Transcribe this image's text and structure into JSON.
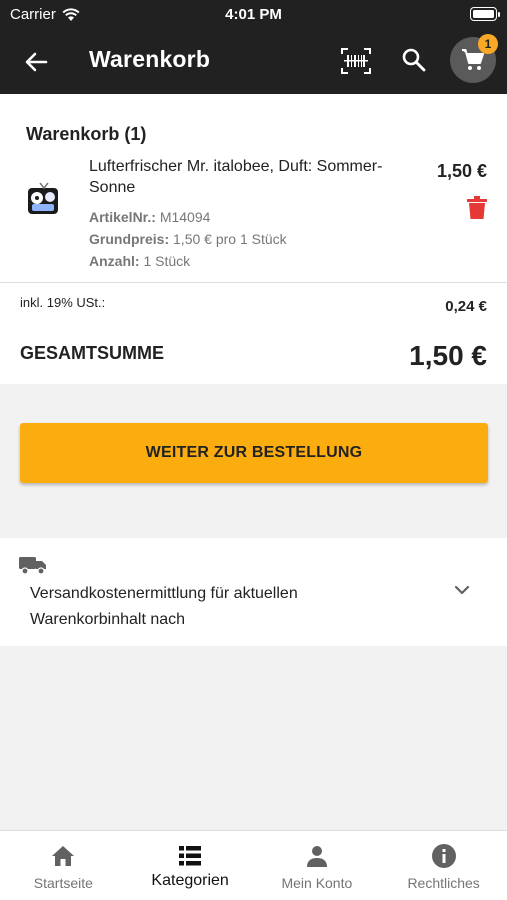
{
  "status_bar": {
    "carrier": "Carrier",
    "time": "4:01 PM"
  },
  "header": {
    "title": "Warenkorb",
    "cart_badge": "1",
    "icons": [
      "back-arrow-icon",
      "barcode-scan-icon",
      "search-icon",
      "cart-icon"
    ]
  },
  "cart": {
    "heading": "Warenkorb (1)",
    "item": {
      "name": "Lufterfrischer Mr. italobee, Duft: Sommer-Sonne",
      "price": "1,50 €",
      "article_label": "ArtikelNr.:",
      "article_value": "M14094",
      "base_price_label": "Grundpreis:",
      "base_price_value": "1,50 € pro 1 Stück",
      "quantity_label": "Anzahl:",
      "quantity_value": "1 Stück"
    },
    "tax_label": "inkl. 19% USt.:",
    "tax_value": "0,24 €",
    "total_label": "GESAMTSUMME",
    "total_value": "1,50 €"
  },
  "checkout_button": "WEITER ZUR BESTELLUNG",
  "shipping": {
    "text": "Versandkostenermittlung für aktuellen Warenkorbinhalt nach"
  },
  "bottom_nav": [
    {
      "label": "Startseite",
      "icon": "home-icon"
    },
    {
      "label": "Kategorien",
      "icon": "list-icon"
    },
    {
      "label": "Mein Konto",
      "icon": "person-icon"
    },
    {
      "label": "Rechtliches",
      "icon": "info-icon"
    }
  ],
  "colors": {
    "header_bg": "#212121",
    "accent": "#fbad10",
    "badge": "#f9a825",
    "delete": "#e53935"
  }
}
